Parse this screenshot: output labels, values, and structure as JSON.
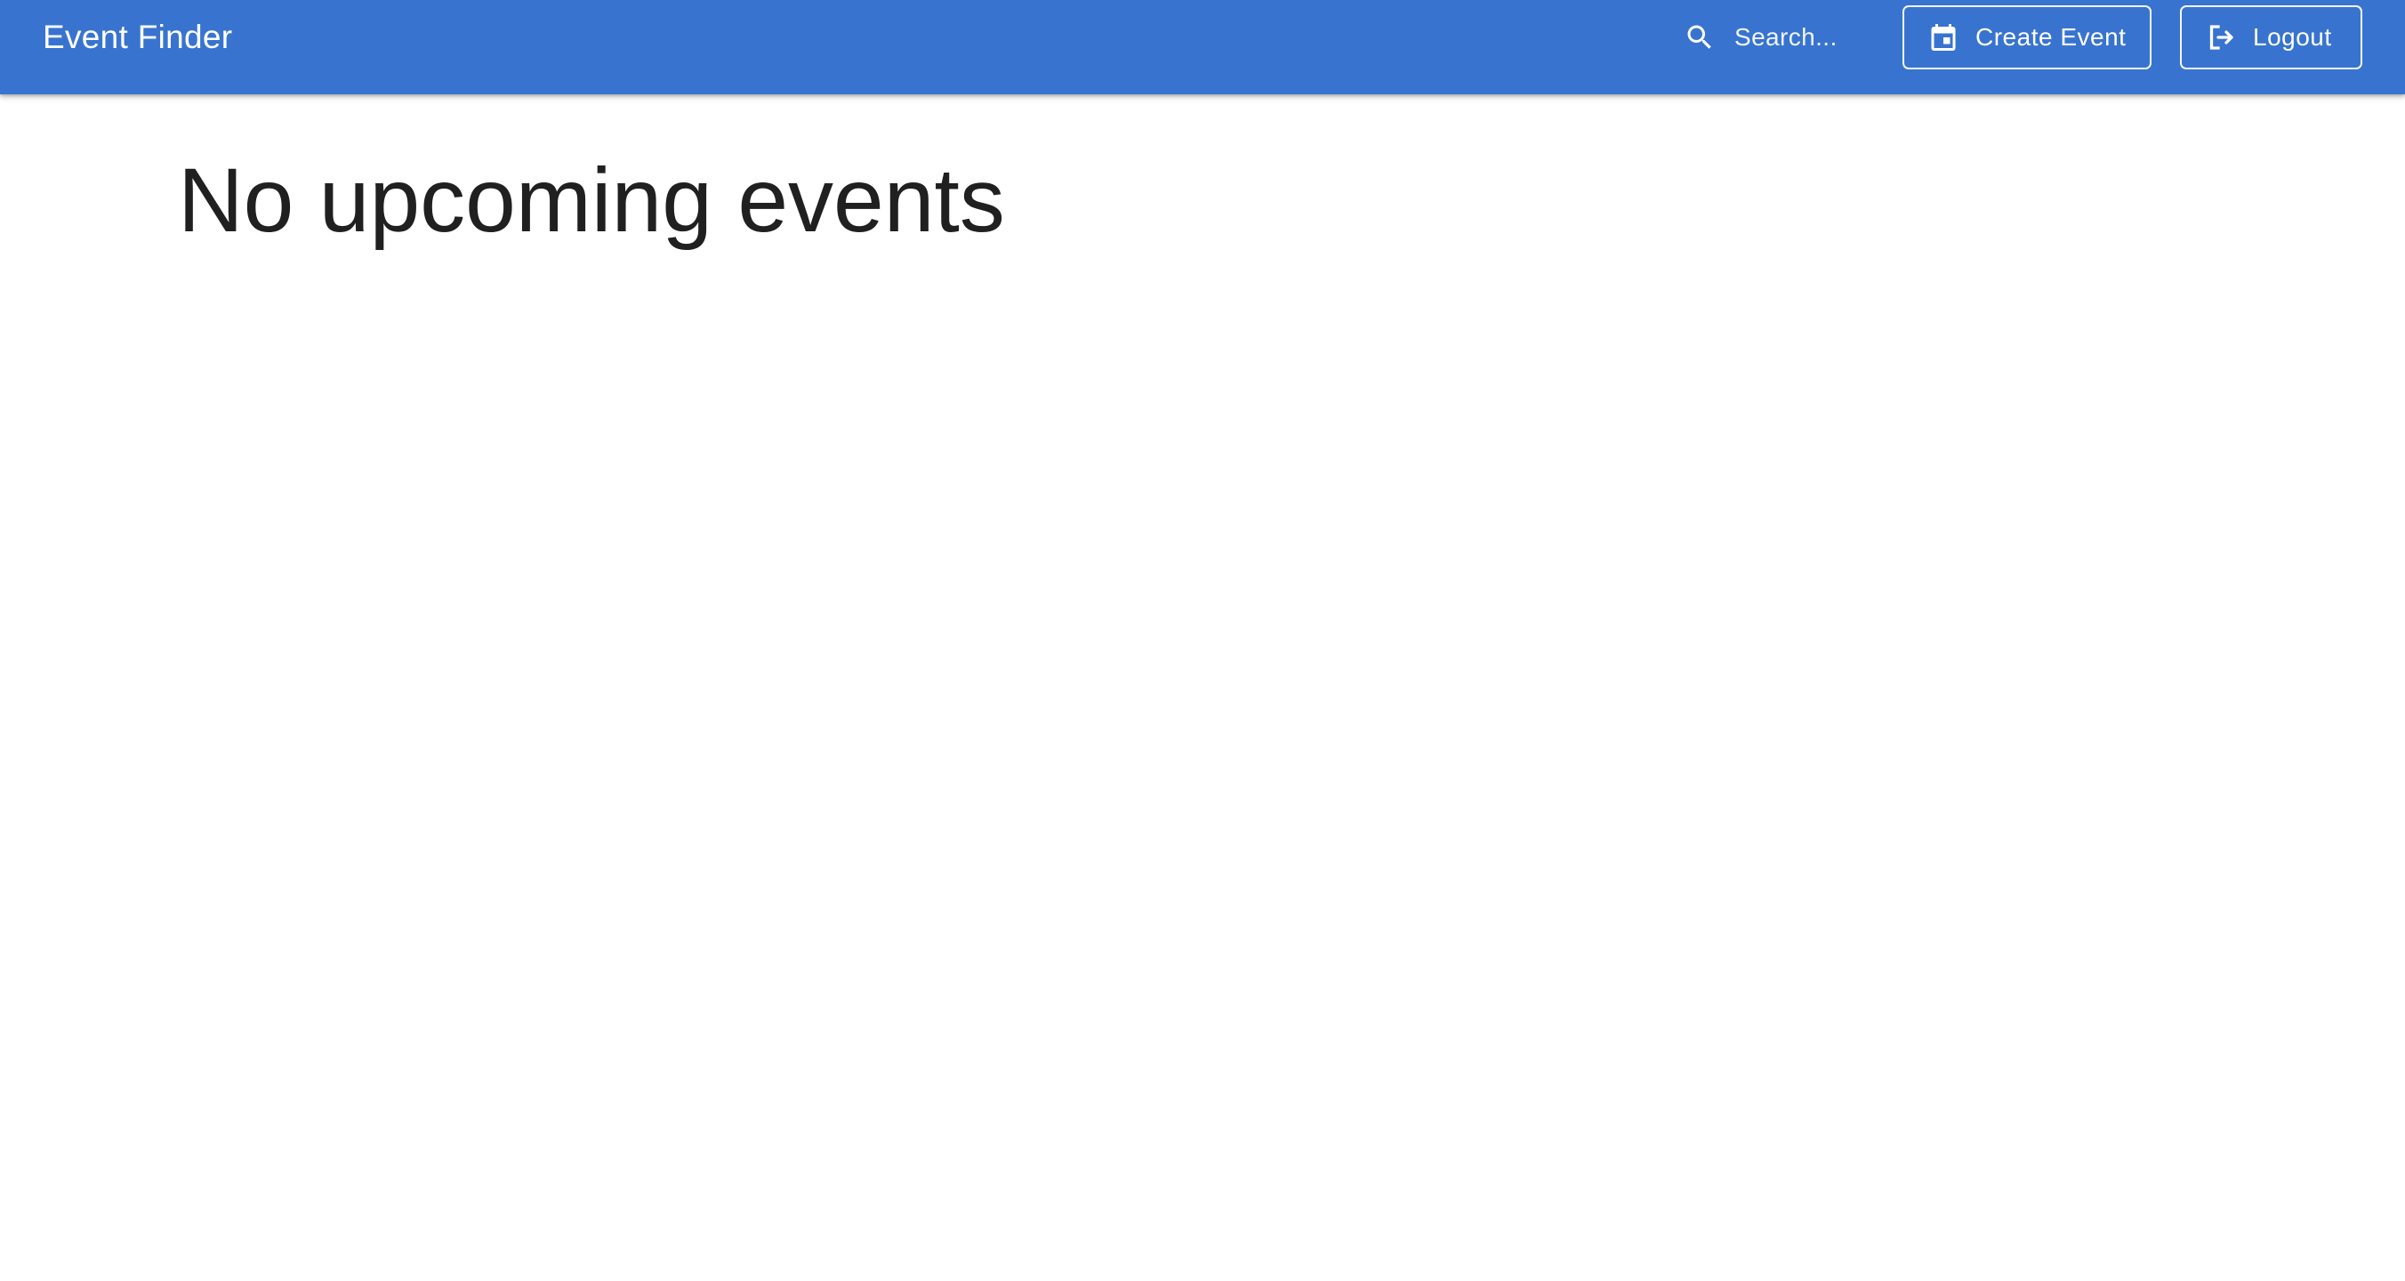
{
  "app": {
    "title": "Event Finder",
    "accent_color": "#3874cf"
  },
  "toolbar": {
    "search": {
      "icon": "search-icon",
      "placeholder": "Search..."
    },
    "create_event": {
      "icon": "calendar-icon",
      "label": "Create Event"
    },
    "logout": {
      "icon": "logout-icon",
      "label": "Logout"
    }
  },
  "main": {
    "empty_message": "No upcoming events"
  }
}
